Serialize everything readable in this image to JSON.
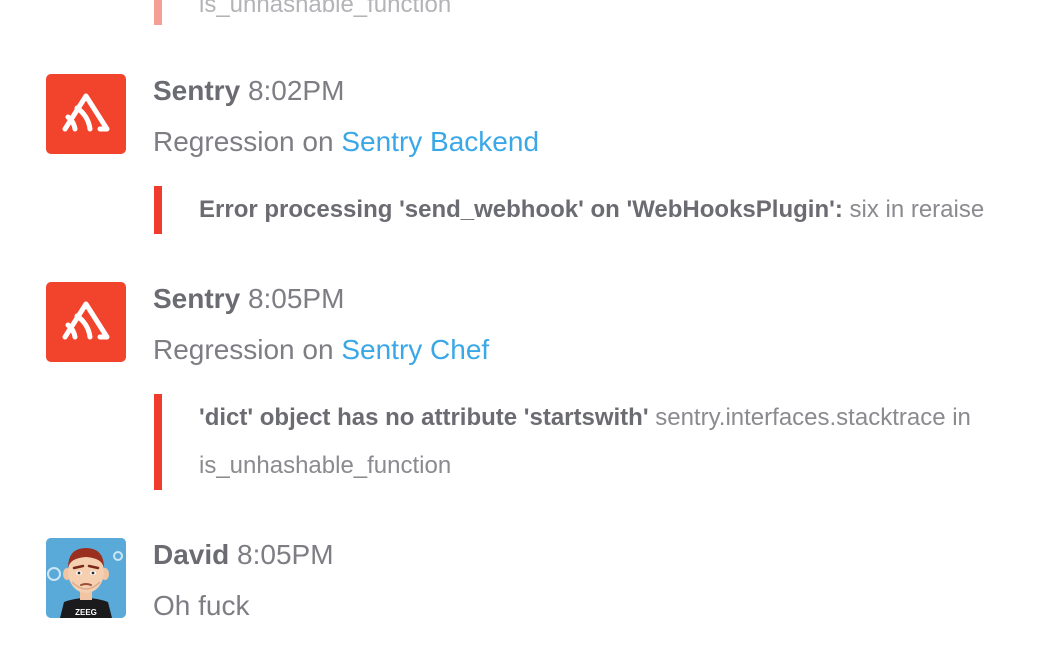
{
  "feed": {
    "top_attachment": {
      "text": "is_unhashable_function"
    },
    "messages": [
      {
        "author": "Sentry",
        "time": "8:02PM",
        "prefix": "Regression on ",
        "link": "Sentry Backend",
        "attachment": {
          "bold": "Error processing 'send_webhook' on 'WebHooksPlugin':",
          "text": " six in reraise"
        }
      },
      {
        "author": "Sentry",
        "time": "8:05PM",
        "prefix": "Regression on ",
        "link": "Sentry Chef",
        "attachment": {
          "bold": "'dict' object has no attribute 'startswith'",
          "text": " sentry.interfaces.stacktrace in",
          "text2": "is_unhashable_function"
        }
      },
      {
        "author": "David",
        "time": "8:05PM",
        "text": "Oh fuck",
        "avatar_caption": "ZEEG"
      }
    ]
  },
  "colors": {
    "sentry_brand": "#f2442c",
    "attachment_bar": "#f03c2e",
    "link": "#3aa8e6",
    "david_avatar_bg": "#59a8d8"
  },
  "icons": {
    "sentry_avatar": "sentry-logo-icon",
    "david_avatar": "cartoon-avatar-icon"
  }
}
